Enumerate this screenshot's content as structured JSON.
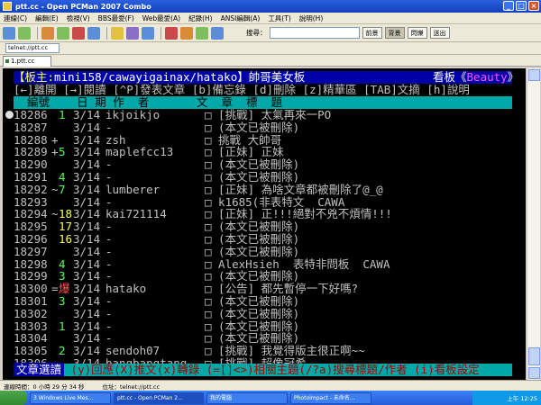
{
  "window": {
    "title": "ptt.cc - Open PCMan 2007 Combo"
  },
  "menu": [
    "連線(C)",
    "編輯(E)",
    "檢視(V)",
    "BBS最愛(F)",
    "Web最愛(A)",
    "紀錄(H)",
    "ANSI編輯(A)",
    "工具(T)",
    "說明(H)"
  ],
  "toolbar": {
    "search_label": "搜尋：",
    "toggles": [
      "前景",
      "背景",
      "閃爍",
      "送出"
    ]
  },
  "address": {
    "value": "telnet://ptt.cc"
  },
  "tabs": [
    {
      "label": "1.ptt.cc"
    }
  ],
  "terminal": {
    "board_bar": {
      "prefix": "【板主:",
      "moderators": "mini158/cawayigainax/hatako",
      "suffix": "】帥哥美女板",
      "board_label": "看板《",
      "board_name": "Beauty",
      "board_close": "》"
    },
    "help_line": "[←]離開 [→]閱讀 [^P]發表文章 [b]備忘錄 [d]刪除 [z]精華區 [TAB]文摘 [h]說明",
    "column_header": "  編號    日 期 作  者       文  章  標  題",
    "rows": [
      {
        "num": "18286",
        "mark": " ",
        "score": "1",
        "score_color": "green",
        "date": "3/14",
        "author": "ikjoikjo",
        "title": "□ [挑戰] 太氣再來一PO"
      },
      {
        "num": "18287",
        "mark": " ",
        "score": "",
        "score_color": "",
        "date": "3/14",
        "author": "-",
        "title": "□ (本文已被刪除)"
      },
      {
        "num": "18288",
        "mark": "+",
        "score": "",
        "score_color": "",
        "date": "3/14",
        "author": "zsh",
        "title": "□ 挑戰 大帥哥"
      },
      {
        "num": "18289",
        "mark": "+",
        "score": "5",
        "score_color": "green",
        "date": "3/14",
        "author": "maplefcc13",
        "title": "□ [正妹] 正妹"
      },
      {
        "num": "18290",
        "mark": " ",
        "score": "",
        "score_color": "",
        "date": "3/14",
        "author": "-",
        "title": "□ (本文已被刪除)"
      },
      {
        "num": "18291",
        "mark": " ",
        "score": "4",
        "score_color": "green",
        "date": "3/14",
        "author": "-",
        "title": "□ (本文已被刪除)"
      },
      {
        "num": "18292",
        "mark": "~",
        "score": "7",
        "score_color": "green",
        "date": "3/14",
        "author": "lumberer",
        "title": "□ [正妹] 為啥文章都被刪除了@_@"
      },
      {
        "num": "18293",
        "mark": " ",
        "score": "",
        "score_color": "",
        "date": "3/14",
        "author": "-",
        "title": "□ k1685(非表特文  CAWA"
      },
      {
        "num": "18294",
        "mark": "~",
        "score": "18",
        "score_color": "yellow",
        "date": "3/14",
        "author": "kai721114",
        "title": "□ [正妹] 正!!!絕對不兇不煩情!!!"
      },
      {
        "num": "18295",
        "mark": " ",
        "score": "17",
        "score_color": "yellow",
        "date": "3/14",
        "author": "-",
        "title": "□ (本文已被刪除)"
      },
      {
        "num": "18296",
        "mark": " ",
        "score": "16",
        "score_color": "yellow",
        "date": "3/14",
        "author": "-",
        "title": "□ (本文已被刪除)"
      },
      {
        "num": "18297",
        "mark": " ",
        "score": "",
        "score_color": "",
        "date": "3/14",
        "author": "-",
        "title": "□ (本文已被刪除)"
      },
      {
        "num": "18298",
        "mark": " ",
        "score": "4",
        "score_color": "green",
        "date": "3/14",
        "author": "-",
        "title": "□ AlexHsieh  表特非問板  CAWA"
      },
      {
        "num": "18299",
        "mark": " ",
        "score": "3",
        "score_color": "green",
        "date": "3/14",
        "author": "-",
        "title": "□ (本文已被刪除)"
      },
      {
        "num": "18300",
        "mark": "=",
        "score": "爆",
        "score_color": "red",
        "date": "3/14",
        "author": "hatako",
        "title": "□ [公告] 都先暫停一下好嗎?"
      },
      {
        "num": "18301",
        "mark": " ",
        "score": "3",
        "score_color": "green",
        "date": "3/14",
        "author": "-",
        "title": "□ (本文已被刪除)"
      },
      {
        "num": "18302",
        "mark": " ",
        "score": "",
        "score_color": "",
        "date": "3/14",
        "author": "-",
        "title": "□ (本文已被刪除)"
      },
      {
        "num": "18303",
        "mark": " ",
        "score": "1",
        "score_color": "green",
        "date": "3/14",
        "author": "-",
        "title": "□ (本文已被刪除)"
      },
      {
        "num": "18304",
        "mark": " ",
        "score": "",
        "score_color": "",
        "date": "3/14",
        "author": "-",
        "title": "□ (本文已被刪除)"
      },
      {
        "num": "18305",
        "mark": " ",
        "score": "2",
        "score_color": "green",
        "date": "3/14",
        "author": "sendoh07",
        "title": "□ [挑戰] 我覺得版主很正啊~~"
      },
      {
        "num": "18306",
        "mark": " ",
        "score": "",
        "score_color": "",
        "date": "3/14",
        "author": "bangbangtang",
        "title": "□ [挑戰] 超像冠希"
      }
    ],
    "footer": {
      "hint": "文章選讀",
      "text": " (y)回應(X)推文(x)轉錄 (=[]<>)相關主題(/?a)搜尋標題/作者 (i)看板設定"
    }
  },
  "status": {
    "connect_time": "連線時間：0 小時 29 分 34 秒",
    "position": "位址：telnet://ptt.cc"
  },
  "taskbar": {
    "buttons": [
      "3 Windows Live Mes...",
      "ptt.cc - Open PCMan 2...",
      "我的電腦",
      "PhotoImpact - 未命名..."
    ],
    "clock": "上午 12:25"
  }
}
